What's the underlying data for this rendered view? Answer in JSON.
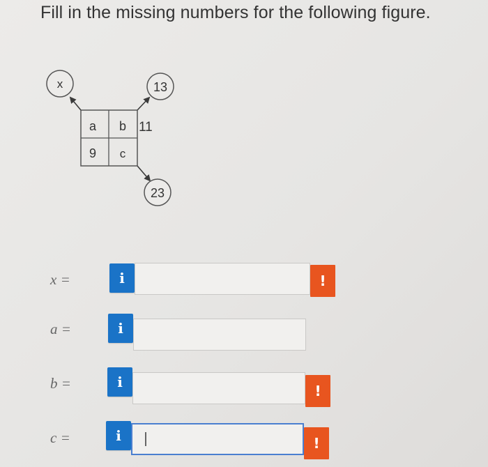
{
  "question": "Fill in the missing numbers for the following figure.",
  "figure": {
    "circle_x": "x",
    "circle_top_right": "13",
    "circle_bottom_right": "23",
    "grid": {
      "top_left": "a",
      "top_right": "b",
      "bottom_left": "9",
      "bottom_right": "c"
    },
    "side_value": "11"
  },
  "answers": [
    {
      "label": "x =",
      "value": "",
      "info_icon": "i",
      "warning_icon": "!",
      "has_warning": true
    },
    {
      "label": "a =",
      "value": "",
      "info_icon": "i",
      "has_warning": false
    },
    {
      "label": "b =",
      "value": "",
      "info_icon": "i",
      "warning_icon": "!",
      "has_warning": true
    },
    {
      "label": "c =",
      "value": "",
      "info_icon": "i",
      "warning_icon": "!",
      "has_warning": true
    }
  ],
  "colors": {
    "info": "#1a73c7",
    "warning": "#e8551f",
    "focus_border": "#4a7fd0"
  }
}
